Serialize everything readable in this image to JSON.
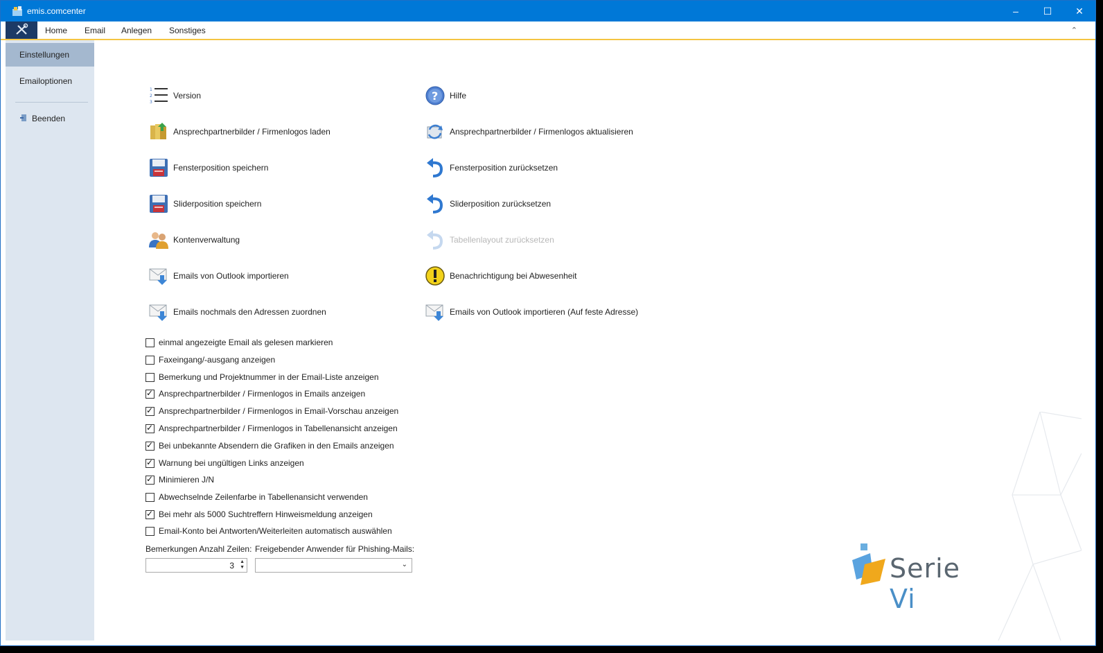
{
  "window": {
    "title": "emis.comcenter"
  },
  "menu": {
    "items": [
      "Home",
      "Email",
      "Anlegen",
      "Sonstiges"
    ]
  },
  "sidebar": {
    "items": [
      {
        "label": "Einstellungen",
        "active": true
      },
      {
        "label": "Emailoptionen",
        "active": false
      },
      {
        "label": "Beenden",
        "active": false
      }
    ]
  },
  "actions": {
    "left": [
      {
        "label": "Version",
        "icon": "numbered-list-icon"
      },
      {
        "label": "Ansprechpartnerbilder / Firmenlogos laden",
        "icon": "load-images-icon"
      },
      {
        "label": "Fensterposition speichern",
        "icon": "save-floppy-icon"
      },
      {
        "label": "Sliderposition speichern",
        "icon": "save-floppy-icon"
      },
      {
        "label": "Kontenverwaltung",
        "icon": "users-icon"
      },
      {
        "label": "Emails von Outlook importieren",
        "icon": "mail-import-icon"
      },
      {
        "label": "Emails nochmals den Adressen zuordnen",
        "icon": "mail-import-icon"
      }
    ],
    "right": [
      {
        "label": "Hilfe",
        "icon": "help-icon",
        "disabled": false
      },
      {
        "label": "Ansprechpartnerbilder / Firmenlogos aktualisieren",
        "icon": "refresh-images-icon",
        "disabled": false
      },
      {
        "label": "Fensterposition zurücksetzen",
        "icon": "undo-arrow-icon",
        "disabled": false
      },
      {
        "label": "Sliderposition zurücksetzen",
        "icon": "undo-arrow-icon",
        "disabled": false
      },
      {
        "label": "Tabellenlayout zurücksetzen",
        "icon": "undo-arrow-icon",
        "disabled": true
      },
      {
        "label": "Benachrichtigung bei Abwesenheit",
        "icon": "warning-icon",
        "disabled": false
      },
      {
        "label": "Emails von Outlook importieren (Auf feste Adresse)",
        "icon": "mail-import-icon",
        "disabled": false
      }
    ]
  },
  "options": [
    {
      "label": "einmal angezeigte Email als gelesen markieren",
      "checked": false
    },
    {
      "label": "Faxeingang/-ausgang anzeigen",
      "checked": false
    },
    {
      "label": "Bemerkung und Projektnummer in der Email-Liste anzeigen",
      "checked": false
    },
    {
      "label": "Ansprechpartnerbilder / Firmenlogos in Emails anzeigen",
      "checked": true
    },
    {
      "label": "Ansprechpartnerbilder / Firmenlogos in Email-Vorschau anzeigen",
      "checked": true
    },
    {
      "label": "Ansprechpartnerbilder / Firmenlogos in Tabellenansicht anzeigen",
      "checked": true
    },
    {
      "label": "Bei unbekannte Absendern die Grafiken in den Emails anzeigen",
      "checked": true
    },
    {
      "label": "Warnung bei ungültigen Links anzeigen",
      "checked": true
    },
    {
      "label": "Minimieren J/N",
      "checked": true
    },
    {
      "label": "Abwechselnde Zeilenfarbe in Tabellenansicht verwenden",
      "checked": false
    },
    {
      "label": "Bei mehr als 5000 Suchtreffern Hinweismeldung anzeigen",
      "checked": true
    },
    {
      "label": "Email-Konto bei Antworten/Weiterleiten automatisch auswählen",
      "checked": false
    }
  ],
  "fields": {
    "rows_label": "Bemerkungen Anzahl Zeilen:",
    "rows_value": "3",
    "phishing_label": "Freigebender Anwender für Phishing-Mails:",
    "phishing_value": ""
  },
  "brand": {
    "text_main": "Serie ",
    "text_accent": "Vi"
  }
}
